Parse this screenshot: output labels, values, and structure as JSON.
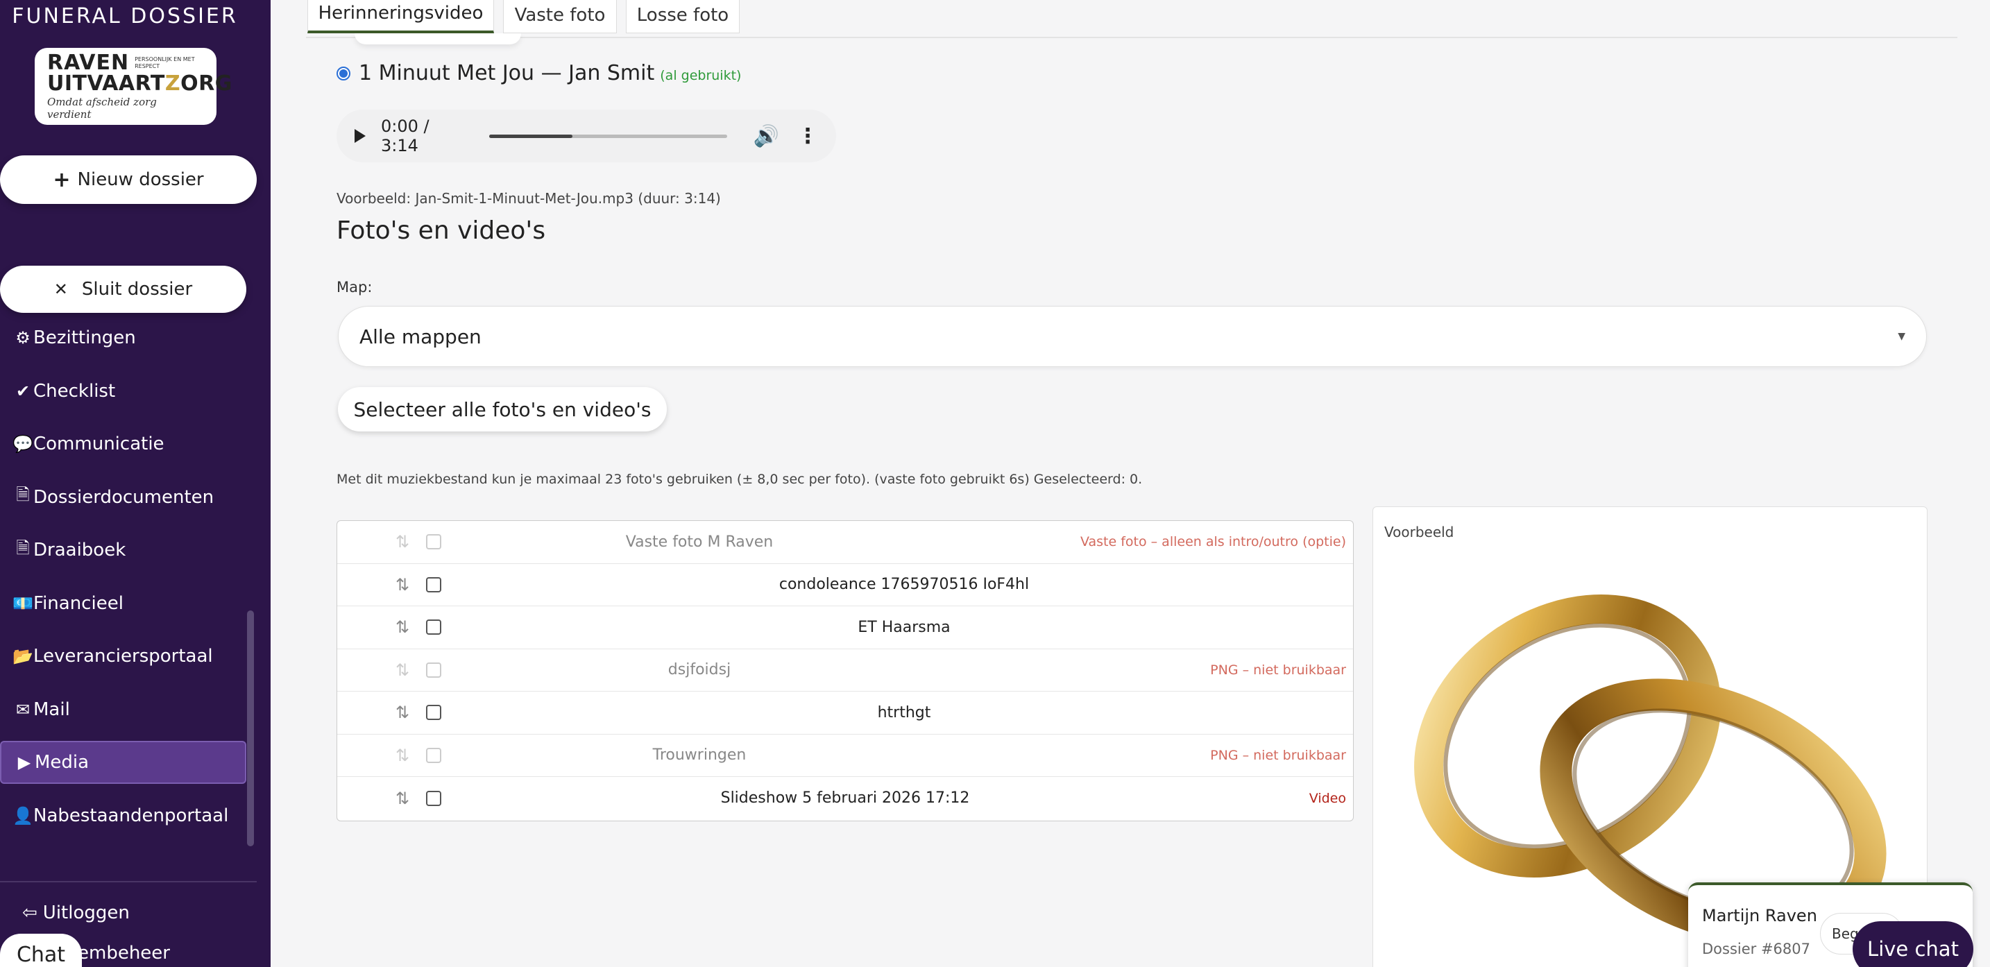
{
  "sidebar": {
    "brand_title": "FUNERAL DOSSIER",
    "logo": {
      "line1": "RAVEN",
      "line1_small": "PERSOONLIJK EN MET RESPECT",
      "line2_a": "UITVAART",
      "line2_b": "Z",
      "line2_c": "ORG",
      "tagline": "Omdat afscheid zorg verdient"
    },
    "new_dossier": {
      "glyph": "+",
      "label": "Nieuw dossier"
    },
    "close_dossier": {
      "glyph": "✕",
      "label": "Sluit dossier"
    },
    "items": [
      {
        "label": "Bezittingen",
        "icon": "gear-icon",
        "glyph": "⚙"
      },
      {
        "label": "Checklist",
        "icon": "check-circle-icon",
        "glyph": "✔"
      },
      {
        "label": "Communicatie",
        "icon": "speech-bubble-icon",
        "glyph": "💬"
      },
      {
        "label": "Dossierdocumenten",
        "icon": "document-icon",
        "glyph": "🗎"
      },
      {
        "label": "Draaiboek",
        "icon": "document-icon",
        "glyph": "🗎"
      },
      {
        "label": "Financieel",
        "icon": "money-icon",
        "glyph": "💶"
      },
      {
        "label": "Leveranciersportaal",
        "icon": "folder-icon",
        "glyph": "📂"
      },
      {
        "label": "Mail",
        "icon": "envelope-icon",
        "glyph": "✉"
      },
      {
        "label": "Media",
        "icon": "media-icon",
        "glyph": "▶"
      },
      {
        "label": "Nabestaandenportaal",
        "icon": "person-icon",
        "glyph": "👤"
      }
    ],
    "active_item": "Media",
    "logout": {
      "label": "Uitloggen",
      "glyph": "⇦"
    },
    "systeembeheer": "eembeheer",
    "chat_label": "Chat"
  },
  "tabs": [
    {
      "label": "Herinneringsvideo",
      "active": true
    },
    {
      "label": "Vaste foto",
      "active": false
    },
    {
      "label": "Losse foto",
      "active": false
    }
  ],
  "music": {
    "selected_label": "1 Minuut Met Jou — Jan Smit",
    "used_tag": "(al gebruikt)",
    "player_time": "0:00 / 3:14",
    "progress": 0.35,
    "preview_line": "Voorbeeld: Jan-Smit-1-Minuut-Met-Jou.mp3 (duur: 3:14)"
  },
  "photos": {
    "section_title": "Foto's en video's",
    "map_label": "Map:",
    "map_selected": "Alle mappen",
    "select_all_label": "Selecteer alle foto's en video's",
    "info_line": "Met dit muziekbestand kun je maximaal 23 foto's gebruiken (± 8,0 sec per foto). (vaste foto gebruikt 6s) Geselecteerd: 0.",
    "rows": [
      {
        "name": "Vaste foto M Raven",
        "note": "Vaste foto – alleen als intro/outro (optie)",
        "disabled": true,
        "type": "fixed"
      },
      {
        "name": "condoleance 1765970516 IoF4hl",
        "note": "",
        "disabled": false,
        "type": "photo"
      },
      {
        "name": "ET Haarsma",
        "note": "",
        "disabled": false,
        "type": "photo"
      },
      {
        "name": "dsjfoidsj",
        "note": "PNG – niet bruikbaar",
        "disabled": true,
        "type": "png"
      },
      {
        "name": "htrthgt",
        "note": "",
        "disabled": false,
        "type": "photo"
      },
      {
        "name": "Trouwringen",
        "note": "PNG – niet bruikbaar",
        "disabled": true,
        "type": "png"
      },
      {
        "name": "Slideshow 5 februari 2026 17:12",
        "note": "Video",
        "disabled": false,
        "type": "video"
      }
    ],
    "preview_label": "Voorbeeld"
  },
  "live_chat": {
    "agent_name": "Martijn Raven",
    "dossier": "Dossier #6807",
    "begr_label": "Begr",
    "button_label": "Live chat"
  },
  "colors": {
    "sidebar_bg": "#2c1549",
    "active_nav": "#5b3a8c",
    "tab_accent": "#3c5a2a",
    "warning_red": "#c0392b",
    "used_green": "#2f9a3a"
  }
}
